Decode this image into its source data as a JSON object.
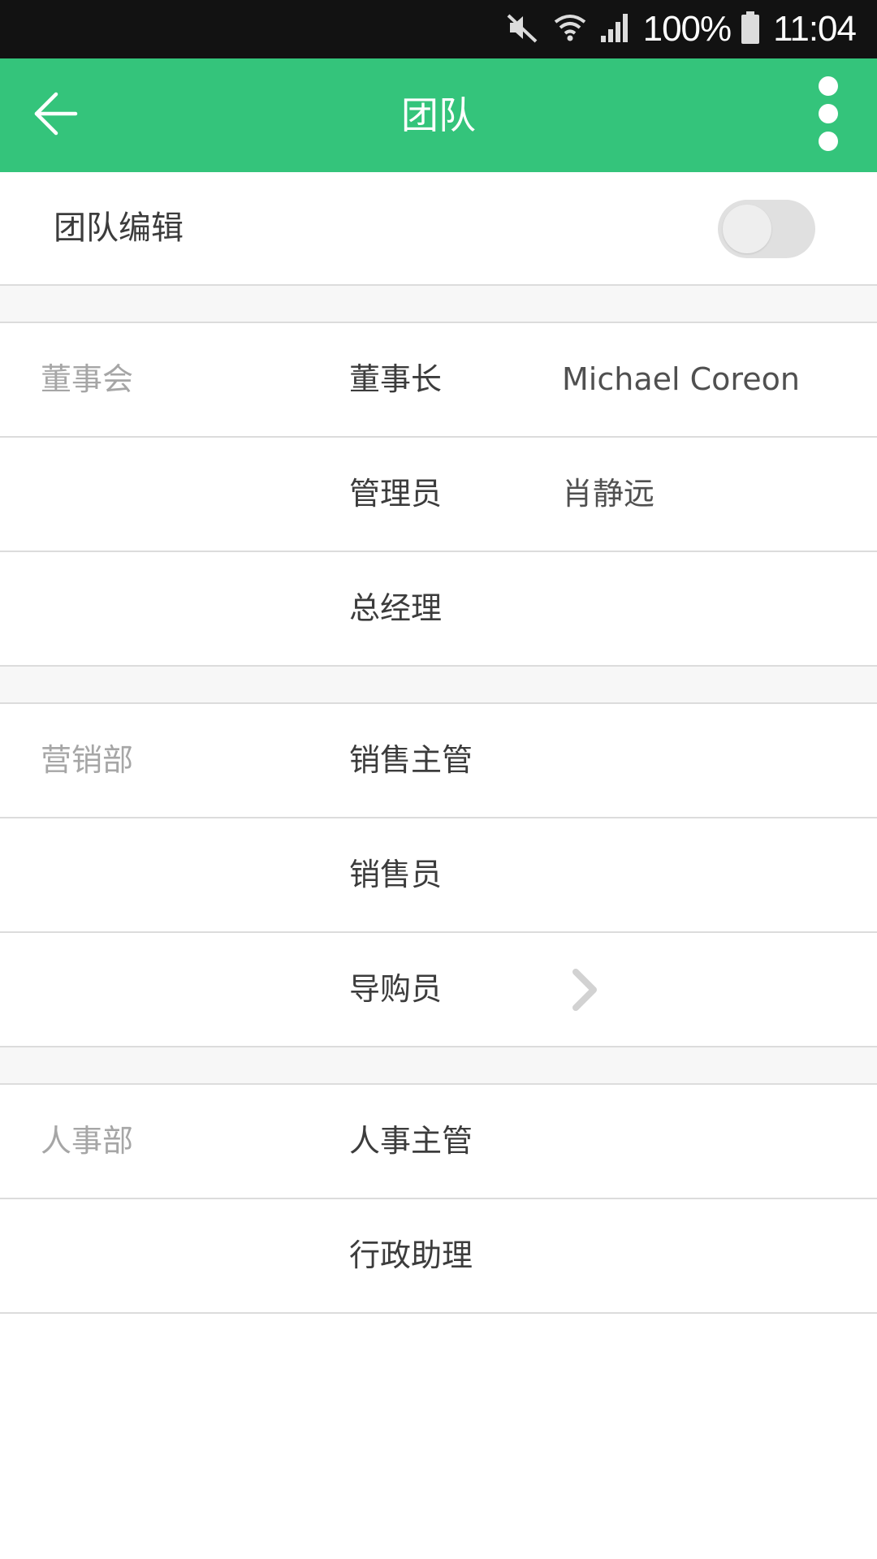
{
  "status_bar": {
    "battery": "100%",
    "time": "11:04",
    "icons": [
      "mute-icon",
      "wifi-icon",
      "signal-icon",
      "battery-icon"
    ]
  },
  "toolbar": {
    "title": "团队",
    "back_icon": "back-arrow-icon",
    "more_icon": "more-vert-icon",
    "background": "#34c47b"
  },
  "team_edit": {
    "label": "团队编辑",
    "toggle_on": false
  },
  "sections": [
    {
      "dept": "董事会",
      "rows": [
        {
          "role": "董事长",
          "member": "Michael Coreon"
        },
        {
          "role": "管理员",
          "member": "肖静远"
        },
        {
          "role": "总经理",
          "member": ""
        }
      ]
    },
    {
      "dept": "营销部",
      "rows": [
        {
          "role": "销售主管",
          "member": ""
        },
        {
          "role": "销售员",
          "member": ""
        },
        {
          "role": "导购员",
          "member": "",
          "chevron": "chevron-right-icon"
        }
      ]
    },
    {
      "dept": "人事部",
      "rows": [
        {
          "role": "人事主管",
          "member": ""
        },
        {
          "role": "行政助理",
          "member": ""
        }
      ]
    }
  ]
}
